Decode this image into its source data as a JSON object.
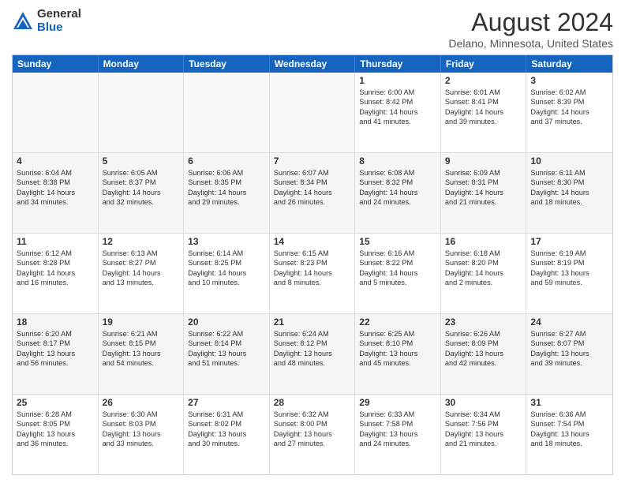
{
  "header": {
    "logo_general": "General",
    "logo_blue": "Blue",
    "month_year": "August 2024",
    "location": "Delano, Minnesota, United States"
  },
  "calendar": {
    "weekdays": [
      "Sunday",
      "Monday",
      "Tuesday",
      "Wednesday",
      "Thursday",
      "Friday",
      "Saturday"
    ],
    "rows": [
      [
        {
          "day": "",
          "text": ""
        },
        {
          "day": "",
          "text": ""
        },
        {
          "day": "",
          "text": ""
        },
        {
          "day": "",
          "text": ""
        },
        {
          "day": "1",
          "text": "Sunrise: 6:00 AM\nSunset: 8:42 PM\nDaylight: 14 hours\nand 41 minutes."
        },
        {
          "day": "2",
          "text": "Sunrise: 6:01 AM\nSunset: 8:41 PM\nDaylight: 14 hours\nand 39 minutes."
        },
        {
          "day": "3",
          "text": "Sunrise: 6:02 AM\nSunset: 8:39 PM\nDaylight: 14 hours\nand 37 minutes."
        }
      ],
      [
        {
          "day": "4",
          "text": "Sunrise: 6:04 AM\nSunset: 8:38 PM\nDaylight: 14 hours\nand 34 minutes."
        },
        {
          "day": "5",
          "text": "Sunrise: 6:05 AM\nSunset: 8:37 PM\nDaylight: 14 hours\nand 32 minutes."
        },
        {
          "day": "6",
          "text": "Sunrise: 6:06 AM\nSunset: 8:35 PM\nDaylight: 14 hours\nand 29 minutes."
        },
        {
          "day": "7",
          "text": "Sunrise: 6:07 AM\nSunset: 8:34 PM\nDaylight: 14 hours\nand 26 minutes."
        },
        {
          "day": "8",
          "text": "Sunrise: 6:08 AM\nSunset: 8:32 PM\nDaylight: 14 hours\nand 24 minutes."
        },
        {
          "day": "9",
          "text": "Sunrise: 6:09 AM\nSunset: 8:31 PM\nDaylight: 14 hours\nand 21 minutes."
        },
        {
          "day": "10",
          "text": "Sunrise: 6:11 AM\nSunset: 8:30 PM\nDaylight: 14 hours\nand 18 minutes."
        }
      ],
      [
        {
          "day": "11",
          "text": "Sunrise: 6:12 AM\nSunset: 8:28 PM\nDaylight: 14 hours\nand 16 minutes."
        },
        {
          "day": "12",
          "text": "Sunrise: 6:13 AM\nSunset: 8:27 PM\nDaylight: 14 hours\nand 13 minutes."
        },
        {
          "day": "13",
          "text": "Sunrise: 6:14 AM\nSunset: 8:25 PM\nDaylight: 14 hours\nand 10 minutes."
        },
        {
          "day": "14",
          "text": "Sunrise: 6:15 AM\nSunset: 8:23 PM\nDaylight: 14 hours\nand 8 minutes."
        },
        {
          "day": "15",
          "text": "Sunrise: 6:16 AM\nSunset: 8:22 PM\nDaylight: 14 hours\nand 5 minutes."
        },
        {
          "day": "16",
          "text": "Sunrise: 6:18 AM\nSunset: 8:20 PM\nDaylight: 14 hours\nand 2 minutes."
        },
        {
          "day": "17",
          "text": "Sunrise: 6:19 AM\nSunset: 8:19 PM\nDaylight: 13 hours\nand 59 minutes."
        }
      ],
      [
        {
          "day": "18",
          "text": "Sunrise: 6:20 AM\nSunset: 8:17 PM\nDaylight: 13 hours\nand 56 minutes."
        },
        {
          "day": "19",
          "text": "Sunrise: 6:21 AM\nSunset: 8:15 PM\nDaylight: 13 hours\nand 54 minutes."
        },
        {
          "day": "20",
          "text": "Sunrise: 6:22 AM\nSunset: 8:14 PM\nDaylight: 13 hours\nand 51 minutes."
        },
        {
          "day": "21",
          "text": "Sunrise: 6:24 AM\nSunset: 8:12 PM\nDaylight: 13 hours\nand 48 minutes."
        },
        {
          "day": "22",
          "text": "Sunrise: 6:25 AM\nSunset: 8:10 PM\nDaylight: 13 hours\nand 45 minutes."
        },
        {
          "day": "23",
          "text": "Sunrise: 6:26 AM\nSunset: 8:09 PM\nDaylight: 13 hours\nand 42 minutes."
        },
        {
          "day": "24",
          "text": "Sunrise: 6:27 AM\nSunset: 8:07 PM\nDaylight: 13 hours\nand 39 minutes."
        }
      ],
      [
        {
          "day": "25",
          "text": "Sunrise: 6:28 AM\nSunset: 8:05 PM\nDaylight: 13 hours\nand 36 minutes."
        },
        {
          "day": "26",
          "text": "Sunrise: 6:30 AM\nSunset: 8:03 PM\nDaylight: 13 hours\nand 33 minutes."
        },
        {
          "day": "27",
          "text": "Sunrise: 6:31 AM\nSunset: 8:02 PM\nDaylight: 13 hours\nand 30 minutes."
        },
        {
          "day": "28",
          "text": "Sunrise: 6:32 AM\nSunset: 8:00 PM\nDaylight: 13 hours\nand 27 minutes."
        },
        {
          "day": "29",
          "text": "Sunrise: 6:33 AM\nSunset: 7:58 PM\nDaylight: 13 hours\nand 24 minutes."
        },
        {
          "day": "30",
          "text": "Sunrise: 6:34 AM\nSunset: 7:56 PM\nDaylight: 13 hours\nand 21 minutes."
        },
        {
          "day": "31",
          "text": "Sunrise: 6:36 AM\nSunset: 7:54 PM\nDaylight: 13 hours\nand 18 minutes."
        }
      ]
    ]
  }
}
